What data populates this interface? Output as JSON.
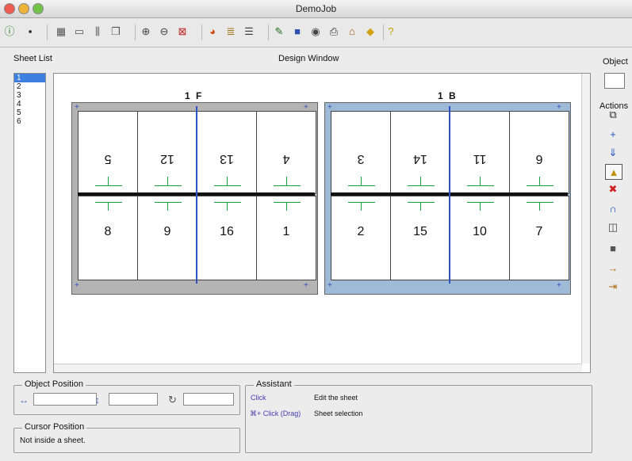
{
  "window": {
    "title": "DemoJob"
  },
  "toolbar": {
    "buttons": [
      {
        "name": "info-icon",
        "glyph": "ⓘ",
        "color": "#1a7a1a"
      },
      {
        "name": "save-icon",
        "glyph": "▪",
        "color": "#222"
      },
      {
        "name": "layout-icon",
        "glyph": "▦",
        "color": "#555"
      },
      {
        "name": "page-icon",
        "glyph": "▭",
        "color": "#555"
      },
      {
        "name": "columns-icon",
        "glyph": "⫼",
        "color": "#555"
      },
      {
        "name": "pages-icon",
        "glyph": "❐",
        "color": "#555"
      },
      {
        "name": "zoom-in-icon",
        "glyph": "⊕",
        "color": "#444"
      },
      {
        "name": "zoom-out-icon",
        "glyph": "⊖",
        "color": "#444"
      },
      {
        "name": "zoom-fit-icon",
        "glyph": "⊠",
        "color": "#c02020"
      },
      {
        "name": "color-icon",
        "glyph": "◕",
        "color": "#d04a10"
      },
      {
        "name": "stack-icon",
        "glyph": "≣",
        "color": "#a07010"
      },
      {
        "name": "list-icon",
        "glyph": "☰",
        "color": "#444"
      },
      {
        "name": "edit-icon",
        "glyph": "✎",
        "color": "#207020"
      },
      {
        "name": "book-icon",
        "glyph": "■",
        "color": "#3050b0"
      },
      {
        "name": "globe-icon",
        "glyph": "◉",
        "color": "#444"
      },
      {
        "name": "print-icon",
        "glyph": "⎙",
        "color": "#333"
      },
      {
        "name": "building-icon",
        "glyph": "⌂",
        "color": "#a06020"
      },
      {
        "name": "tag-icon",
        "glyph": "◆",
        "color": "#d0a010"
      },
      {
        "name": "help-icon",
        "glyph": "?",
        "color": "#c0a000"
      }
    ]
  },
  "labels": {
    "sheet_list": "Sheet List",
    "design_window": "Design Window",
    "object": "Object",
    "actions": "Actions"
  },
  "sheet_list": {
    "items": [
      "1",
      "2",
      "3",
      "4",
      "5",
      "6"
    ],
    "selected": "1"
  },
  "sheets": [
    {
      "label": "1 F",
      "bg": "#b4b4b4",
      "top_pages": [
        "5",
        "12",
        "13",
        "4"
      ],
      "bottom_pages": [
        "8",
        "9",
        "16",
        "1"
      ]
    },
    {
      "label": "1 B",
      "bg": "#9fbad6",
      "top_pages": [
        "3",
        "14",
        "11",
        "6"
      ],
      "bottom_pages": [
        "2",
        "15",
        "10",
        "7"
      ]
    }
  ],
  "actions": [
    {
      "name": "copy-sheet-icon",
      "glyph": "⧉",
      "color": "#333"
    },
    {
      "name": "add-icon",
      "glyph": "+",
      "color": "#2050c0"
    },
    {
      "name": "insert-icon",
      "glyph": "⇓",
      "color": "#2050c0"
    },
    {
      "name": "warning-icon",
      "glyph": "▲",
      "color": "#c09010"
    },
    {
      "name": "delete-icon",
      "glyph": "✖",
      "color": "#d02020"
    },
    {
      "name": "magnet-icon",
      "glyph": "∩",
      "color": "#2050c0"
    },
    {
      "name": "duplicate-icon",
      "glyph": "◫",
      "color": "#444"
    },
    {
      "name": "fill-icon",
      "glyph": "■",
      "color": "#555"
    },
    {
      "name": "move-in-icon",
      "glyph": "→",
      "color": "#b07010"
    },
    {
      "name": "move-out-icon",
      "glyph": "⇥",
      "color": "#b07010"
    }
  ],
  "object_position": {
    "label": "Object Position",
    "h_value": "",
    "v_value": "",
    "rot_value": ""
  },
  "cursor_position": {
    "label": "Cursor Position",
    "text": "Not inside a sheet."
  },
  "assistant": {
    "label": "Assistant",
    "rows": [
      {
        "key": "Click",
        "desc": "Edit the sheet"
      },
      {
        "key": "+ Click (Drag)",
        "desc": "Sheet selection"
      }
    ]
  }
}
